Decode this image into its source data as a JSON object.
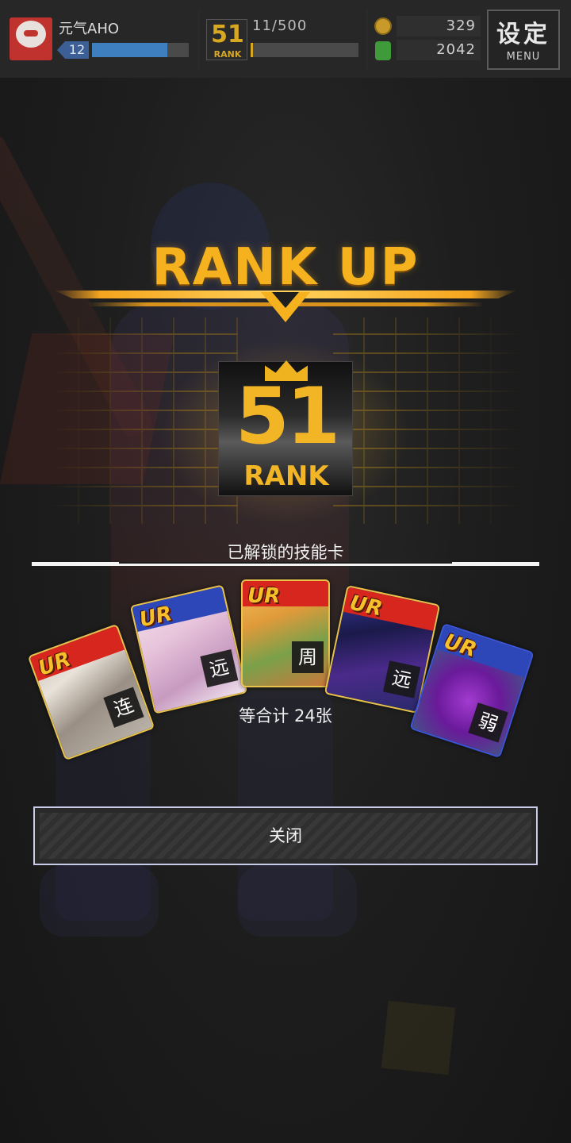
{
  "hud": {
    "player_name": "元气AHO",
    "level": "12",
    "exp_fraction": 0.78,
    "rank_icon_number": "51",
    "rank_icon_label": "RANK",
    "rank_progress": "11/500",
    "rank_progress_fraction": 0.022,
    "coins": "329",
    "gems": "2042",
    "menu_label_cn": "设定",
    "menu_label_en": "MENU"
  },
  "rankup": {
    "title": "RANK UP",
    "rank_number": "51",
    "rank_label": "RANK"
  },
  "unlocked": {
    "label": "已解锁的技能卡",
    "cards": [
      {
        "rarity": "UR",
        "type": "连"
      },
      {
        "rarity": "UR",
        "type": "远"
      },
      {
        "rarity": "UR",
        "type": "周"
      },
      {
        "rarity": "UR",
        "type": "远"
      },
      {
        "rarity": "UR",
        "type": "弱"
      }
    ],
    "total": "等合计 24张"
  },
  "close_button": "关闭",
  "colors": {
    "accent_gold": "#f5b21e",
    "card_red": "#d6261e",
    "card_blue": "#2d46b8",
    "exp_blue": "#3e7fc0"
  }
}
